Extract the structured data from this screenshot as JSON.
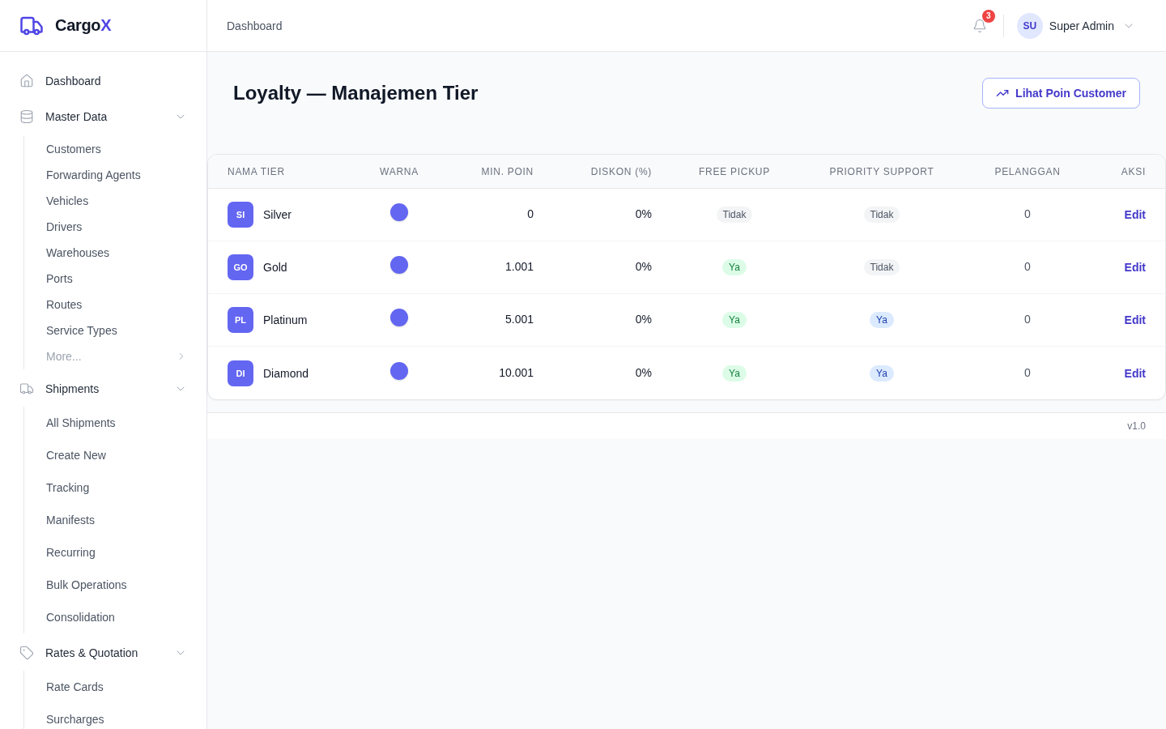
{
  "brand": {
    "name": "Cargo",
    "accent": "X"
  },
  "sidebar": {
    "items": [
      {
        "label": "Dashboard"
      },
      {
        "label": "Master Data",
        "expanded": true,
        "children": [
          {
            "label": "Customers",
            "kind": "link"
          },
          {
            "label": "Forwarding Agents",
            "kind": "link"
          },
          {
            "label": "Vehicles",
            "kind": "link"
          },
          {
            "label": "Drivers",
            "kind": "link"
          },
          {
            "label": "Warehouses",
            "kind": "link"
          },
          {
            "label": "Ports",
            "kind": "link"
          },
          {
            "label": "Routes",
            "kind": "link"
          },
          {
            "label": "Service Types",
            "kind": "link"
          },
          {
            "label": "More...",
            "kind": "more"
          }
        ]
      },
      {
        "label": "Shipments",
        "expanded": true,
        "children": [
          {
            "label": "All Shipments",
            "kind": "link"
          },
          {
            "label": "Create New",
            "kind": "link"
          },
          {
            "label": "Tracking",
            "kind": "link"
          },
          {
            "label": "Manifests",
            "kind": "link"
          },
          {
            "label": "Recurring",
            "kind": "link"
          },
          {
            "label": "Bulk Operations",
            "kind": "link"
          },
          {
            "label": "Consolidation",
            "kind": "link"
          }
        ]
      },
      {
        "label": "Rates & Quotation",
        "expanded": true,
        "children": [
          {
            "label": "Rate Cards",
            "kind": "link"
          },
          {
            "label": "Surcharges",
            "kind": "link"
          }
        ]
      }
    ]
  },
  "header": {
    "breadcrumb": "Dashboard",
    "notifications": {
      "count": "3"
    },
    "user": {
      "initials": "SU",
      "name": "Super Admin"
    }
  },
  "page": {
    "title": "Loyalty — Manajemen Tier",
    "action_button": "Lihat Poin Customer"
  },
  "table": {
    "columns": [
      "NAMA TIER",
      "WARNA",
      "MIN. POIN",
      "DISKON (%)",
      "FREE PICKUP",
      "PRIORITY SUPPORT",
      "PELANGGAN",
      "AKSI"
    ],
    "rows": [
      {
        "initials": "SI",
        "name": "Silver",
        "color": "#6366f1",
        "min_points": "0",
        "discount": "0%",
        "free_pickup": {
          "label": "Tidak",
          "on": false
        },
        "priority_support": {
          "label": "Tidak",
          "on": false
        },
        "customers": "0",
        "action": "Edit"
      },
      {
        "initials": "GO",
        "name": "Gold",
        "color": "#6366f1",
        "min_points": "1.001",
        "discount": "0%",
        "free_pickup": {
          "label": "Ya",
          "on": true
        },
        "priority_support": {
          "label": "Tidak",
          "on": false
        },
        "customers": "0",
        "action": "Edit"
      },
      {
        "initials": "PL",
        "name": "Platinum",
        "color": "#6366f1",
        "min_points": "5.001",
        "discount": "0%",
        "free_pickup": {
          "label": "Ya",
          "on": true
        },
        "priority_support": {
          "label": "Ya",
          "on": true
        },
        "customers": "0",
        "action": "Edit"
      },
      {
        "initials": "DI",
        "name": "Diamond",
        "color": "#6366f1",
        "min_points": "10.001",
        "discount": "0%",
        "free_pickup": {
          "label": "Ya",
          "on": true
        },
        "priority_support": {
          "label": "Ya",
          "on": true
        },
        "customers": "0",
        "action": "Edit"
      }
    ]
  },
  "footer": {
    "version": "v1.0"
  }
}
